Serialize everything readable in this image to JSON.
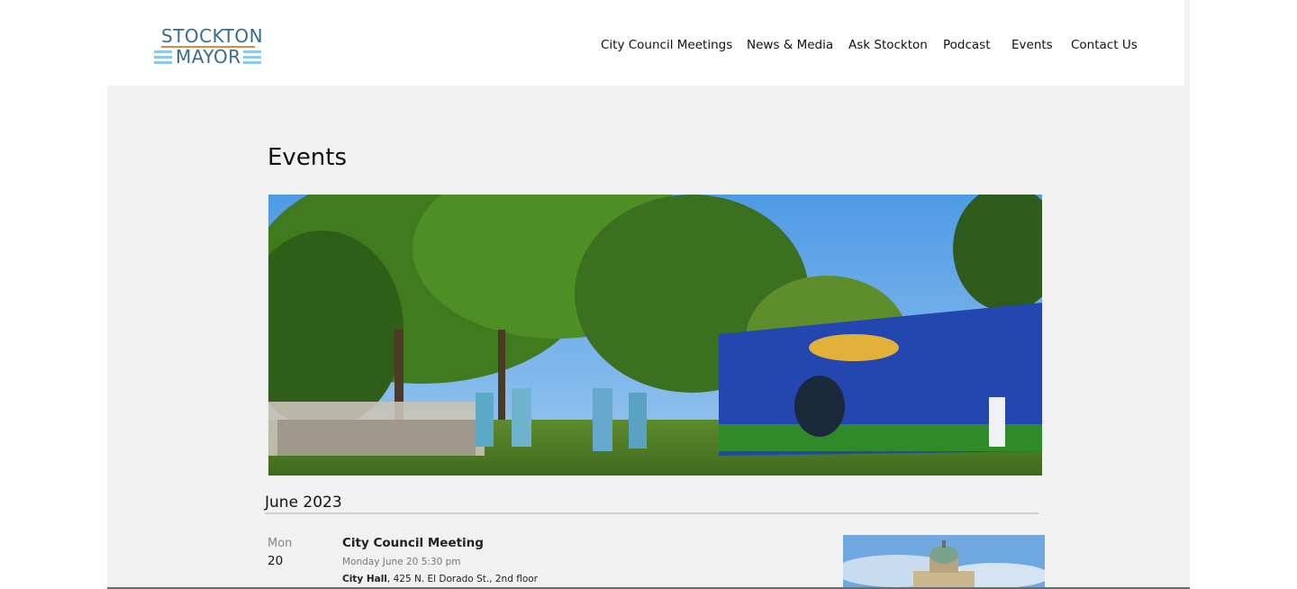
{
  "logo": {
    "line1": "STOCKTON",
    "line2": "MAYOR"
  },
  "nav": {
    "items": [
      {
        "label": "City Council Meetings"
      },
      {
        "label": "News & Media"
      },
      {
        "label": "Ask Stockton"
      },
      {
        "label": "Podcast"
      },
      {
        "label": "Events"
      },
      {
        "label": "Contact Us"
      }
    ]
  },
  "page": {
    "title": "Events"
  },
  "events": {
    "month": "June 2023",
    "items": [
      {
        "dow": "Mon",
        "day": "20",
        "title": "City Council Meeting",
        "when": "Monday June 20 5:30 pm",
        "venue": "City Hall",
        "address": ", 425 N. El Dorado St., 2nd floor"
      }
    ]
  },
  "colors": {
    "logo_text": "#3a6a8c",
    "logo_accent": "#e08a3c",
    "logo_bars": "#8ec7ea",
    "page_bg": "#f1f1f1"
  }
}
